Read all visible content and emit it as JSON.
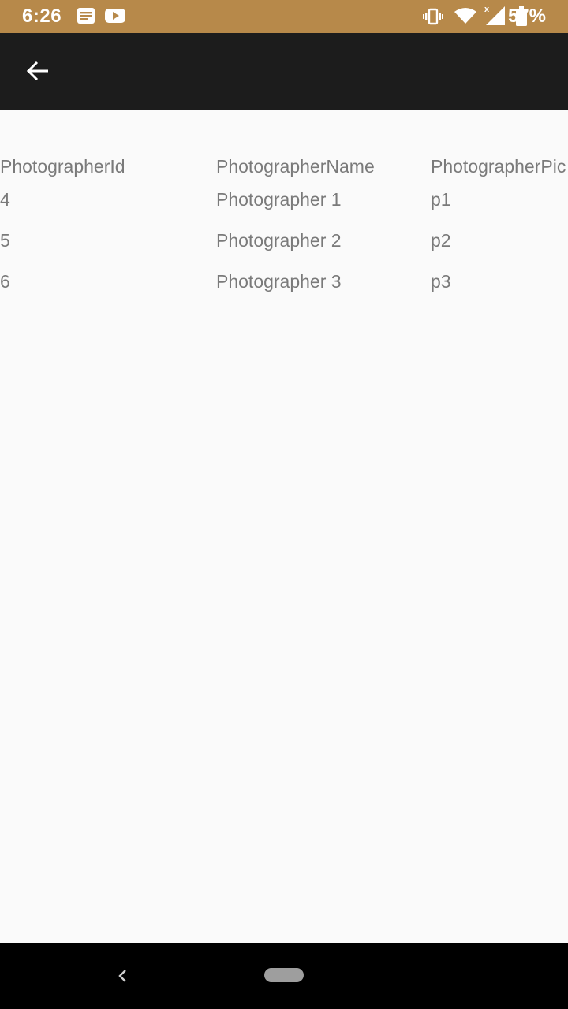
{
  "status_bar": {
    "time": "6:26",
    "battery_percent": "57%",
    "background_color": "#b7894a",
    "notification_icons": [
      "news-icon",
      "youtube-icon"
    ],
    "system_icons": [
      "vibrate-icon",
      "wifi-icon",
      "signal-icon",
      "battery-icon"
    ]
  },
  "toolbar": {
    "background_color": "#1c1c1c",
    "back_icon": "arrow-left-icon"
  },
  "table": {
    "columns": [
      "PhotographerId",
      "PhotographerName",
      "PhotographerPic"
    ],
    "rows": [
      [
        "4",
        "Photographer 1",
        "p1"
      ],
      [
        "5",
        "Photographer 2",
        "p2"
      ],
      [
        "6",
        "Photographer 3",
        "p3"
      ]
    ]
  },
  "nav_bar": {
    "back_icon": "chevron-left-icon",
    "home_icon": "home-pill-icon"
  }
}
